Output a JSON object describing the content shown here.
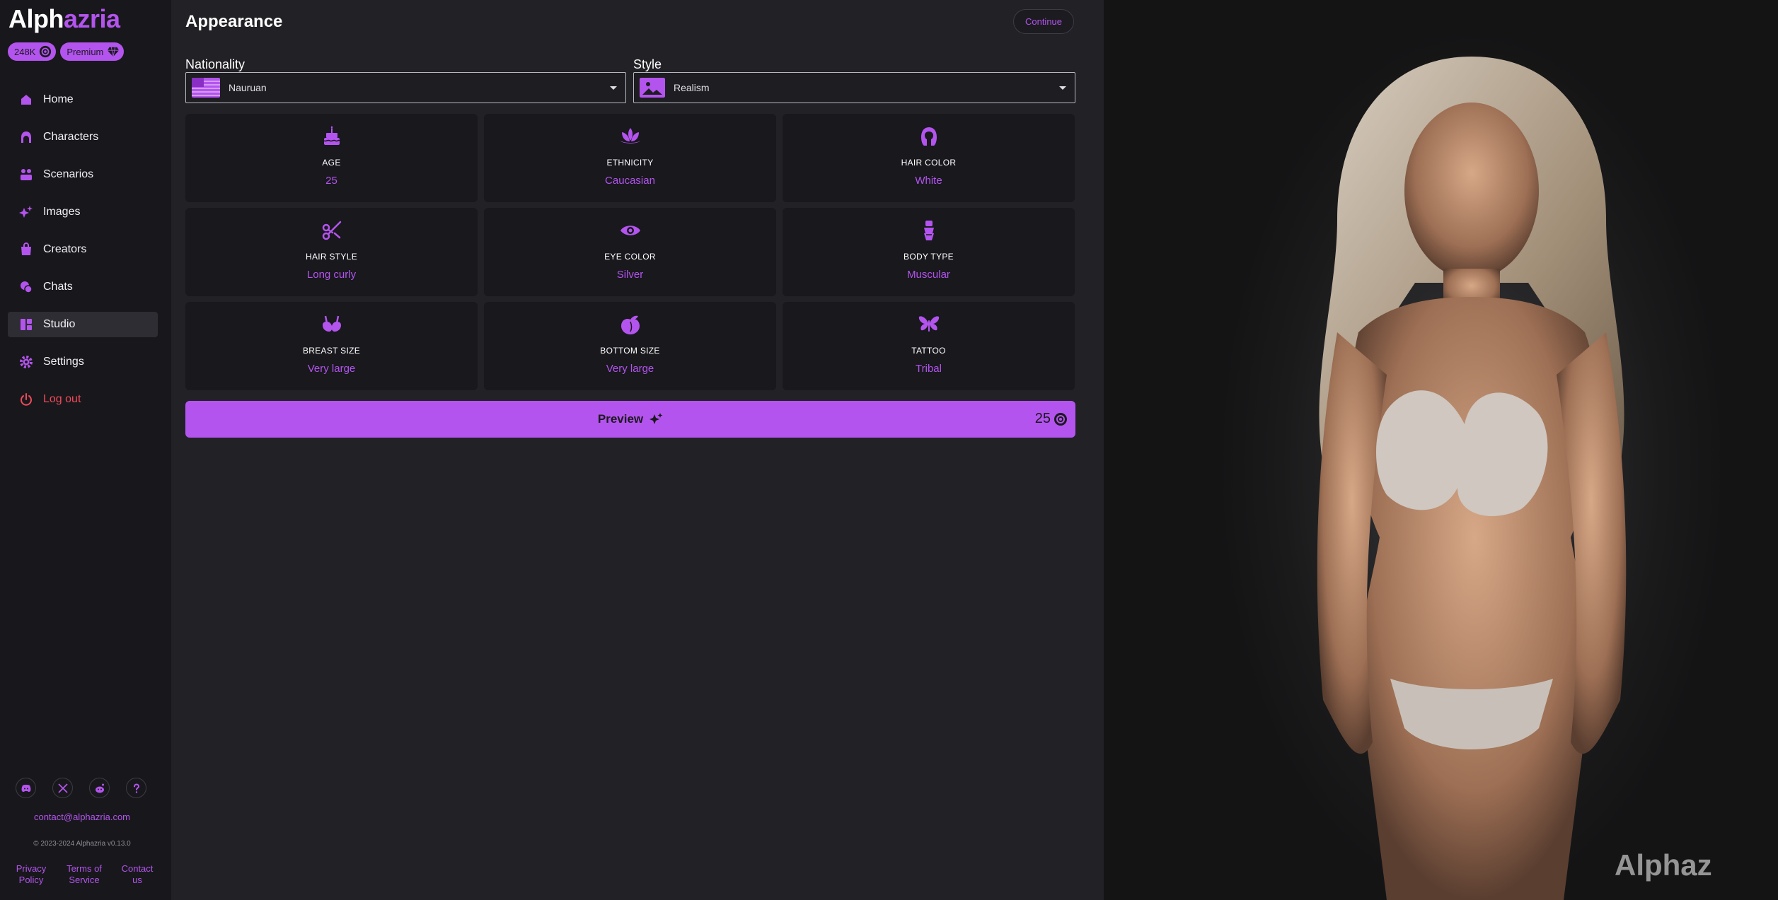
{
  "brand": {
    "part1": "Alph",
    "part2": "azria"
  },
  "badges": {
    "credits": "248K",
    "premium": "Premium"
  },
  "nav": {
    "home": "Home",
    "characters": "Characters",
    "scenarios": "Scenarios",
    "images": "Images",
    "creators": "Creators",
    "chats": "Chats",
    "studio": "Studio",
    "settings": "Settings",
    "logout": "Log out"
  },
  "footer": {
    "email": "contact@alphazria.com",
    "copyright": "© 2023-2024 Alphazria v0.13.0",
    "privacy": "Privacy Policy",
    "terms": "Terms of Service",
    "contact": "Contact us"
  },
  "page": {
    "title": "Appearance",
    "continue": "Continue"
  },
  "fields": {
    "nationality": {
      "label": "Nationality",
      "value": "Nauruan"
    },
    "style": {
      "label": "Style",
      "value": "Realism"
    }
  },
  "attributes": [
    {
      "label": "AGE",
      "value": "25",
      "icon": "cake-icon"
    },
    {
      "label": "ETHNICITY",
      "value": "Caucasian",
      "icon": "lotus-icon"
    },
    {
      "label": "HAIR COLOR",
      "value": "White",
      "icon": "hair-icon"
    },
    {
      "label": "HAIR STYLE",
      "value": "Long curly",
      "icon": "scissors-icon"
    },
    {
      "label": "EYE COLOR",
      "value": "Silver",
      "icon": "eye-icon"
    },
    {
      "label": "BODY TYPE",
      "value": "Muscular",
      "icon": "body-icon"
    },
    {
      "label": "BREAST SIZE",
      "value": "Very large",
      "icon": "bra-icon"
    },
    {
      "label": "BOTTOM SIZE",
      "value": "Very large",
      "icon": "peach-icon"
    },
    {
      "label": "TATTOO",
      "value": "Tribal",
      "icon": "butterfly-icon"
    }
  ],
  "preview": {
    "label": "Preview",
    "cost": "25"
  },
  "photo": {
    "watermark": "Alphaz"
  },
  "colors": {
    "accent": "#b454ee",
    "background": "#212126",
    "sidebar": "#18181c",
    "danger": "#ef4a5a"
  }
}
